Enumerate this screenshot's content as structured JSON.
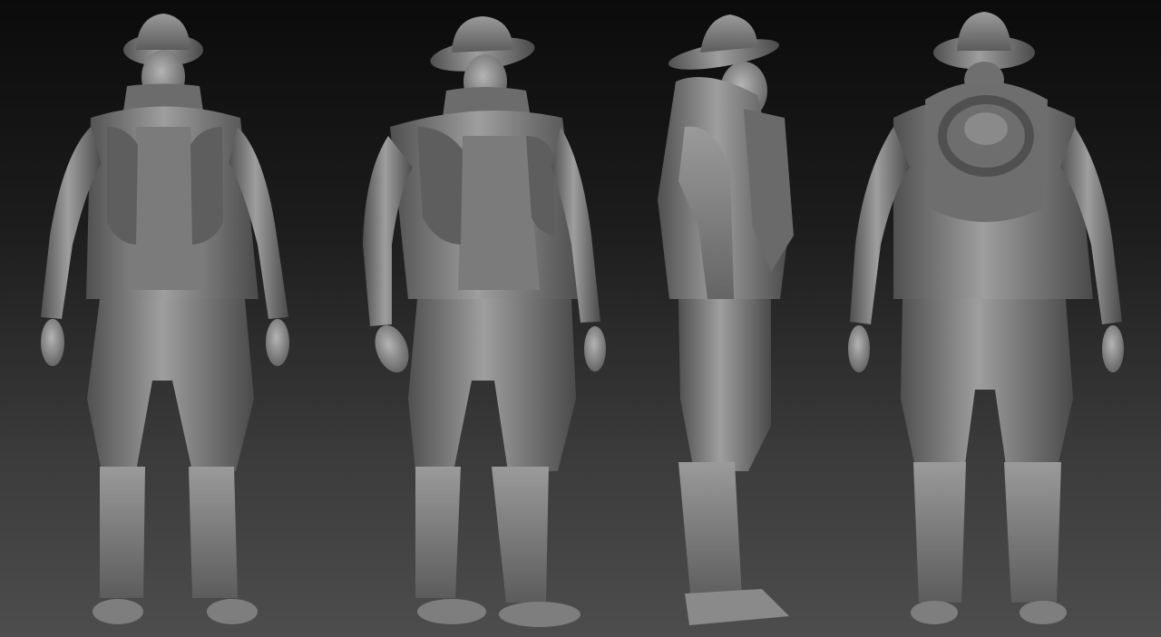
{
  "scene": {
    "views": [
      "front",
      "three-quarter",
      "side",
      "back"
    ],
    "colors": {
      "background_top": "#0b0b0b",
      "background_bottom": "#4d4d4d",
      "clay_light": "#a2a2a2",
      "clay_mid": "#7a7a7a",
      "clay_dark": "#3e3e3e"
    }
  }
}
